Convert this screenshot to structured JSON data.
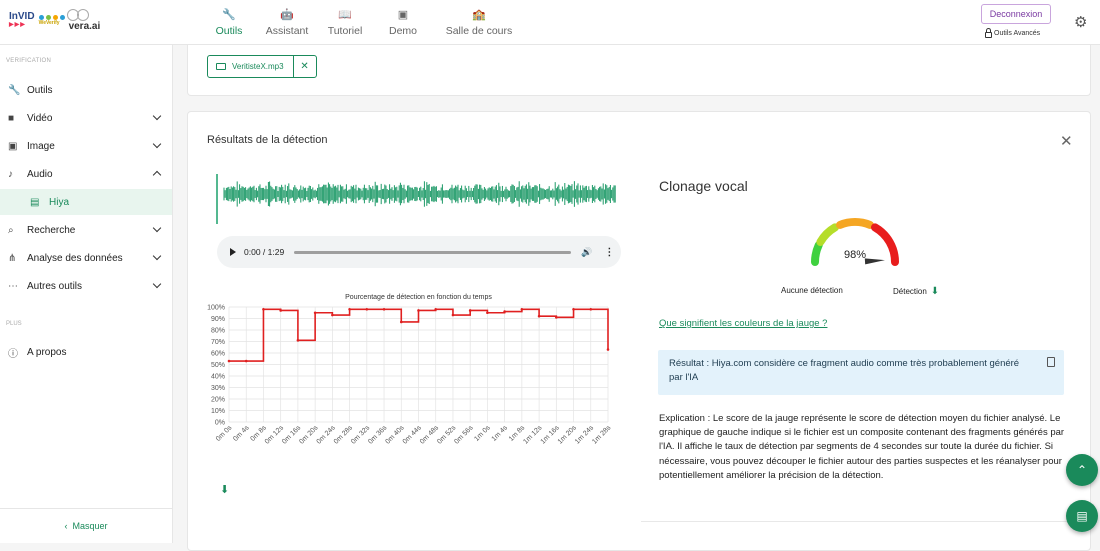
{
  "logo": {
    "invid": "InVID",
    "wev": "WeVerify",
    "vera": "vera.ai"
  },
  "nav": {
    "items": [
      {
        "label": "Outils",
        "icon": "wrench-icon",
        "glyph": "🔧"
      },
      {
        "label": "Assistant",
        "icon": "robot-icon",
        "glyph": "🤖"
      },
      {
        "label": "Tutoriel",
        "icon": "book-icon",
        "glyph": "📖"
      },
      {
        "label": "Demo",
        "icon": "video-icon",
        "glyph": "▣"
      },
      {
        "label": "Salle de cours",
        "icon": "classroom-icon",
        "glyph": "🏫"
      }
    ],
    "active": 0
  },
  "header": {
    "logout": "Deconnexion",
    "advanced": "Outils Avancés"
  },
  "sidebar": {
    "heading": "VERIFICATION",
    "items": [
      {
        "label": "Outils",
        "glyph": "🔧"
      },
      {
        "label": "Vidéo",
        "glyph": "■"
      },
      {
        "label": "Image",
        "glyph": "▣"
      },
      {
        "label": "Audio",
        "glyph": "♪"
      },
      {
        "label": "Hiya",
        "glyph": "▤"
      },
      {
        "label": "Recherche",
        "glyph": "⌕"
      },
      {
        "label": "Analyse des données",
        "glyph": "⋔"
      },
      {
        "label": "Autres outils",
        "glyph": "⋯"
      }
    ],
    "plus_heading": "PLUS",
    "about": "A propos",
    "hide": "Masquer"
  },
  "file_chip": {
    "name": "VeritisteX.mp3"
  },
  "results": {
    "title": "Résultats de la détection",
    "player": {
      "time": "0:00 / 1:29"
    },
    "clonage_title": "Clonage vocal",
    "gauge": {
      "value": 98,
      "label": "98%",
      "left_label": "Aucune détection",
      "right_label": "Détection"
    },
    "link": "Que signifient les couleurs de la jauge ?",
    "result_text": "Résultat : Hiya.com considère ce fragment audio comme très probablement généré par l'IA",
    "explanation": "Explication : Le score de la jauge représente le score de détection moyen du fichier analysé. Le graphique de gauche indique si le fichier est un composite contenant des fragments générés par l'IA. Il affiche le taux de détection par segments de 4 secondes sur toute la durée du fichier. Si nécessaire, vous pouvez découper le fichier autour des parties suspectes et les réanalyser pour potentiellement améliorer la précision de la détection."
  },
  "chart_data": {
    "type": "line",
    "title": "Pourcentage de détection en fonction du temps",
    "xlabel": "",
    "ylabel": "",
    "ylim": [
      0,
      100
    ],
    "step": true,
    "yticks": [
      "0%",
      "10%",
      "20%",
      "30%",
      "40%",
      "50%",
      "60%",
      "70%",
      "80%",
      "90%",
      "100%"
    ],
    "x": [
      "0m 0s",
      "0m 4s",
      "0m 8s",
      "0m 12s",
      "0m 16s",
      "0m 20s",
      "0m 24s",
      "0m 28s",
      "0m 32s",
      "0m 36s",
      "0m 40s",
      "0m 44s",
      "0m 48s",
      "0m 52s",
      "0m 56s",
      "1m 0s",
      "1m 4s",
      "1m 8s",
      "1m 12s",
      "1m 16s",
      "1m 20s",
      "1m 24s",
      "1m 28s"
    ],
    "series": [
      {
        "color": "#e02020",
        "values": [
          53,
          53,
          98,
          97,
          71,
          95,
          93,
          98,
          98,
          98,
          87,
          97,
          98,
          93,
          97,
          95,
          96,
          98,
          92,
          91,
          98,
          98,
          63
        ]
      }
    ],
    "grid": true
  },
  "colors": {
    "accent": "#1a8a5b",
    "line": "#e02020"
  }
}
